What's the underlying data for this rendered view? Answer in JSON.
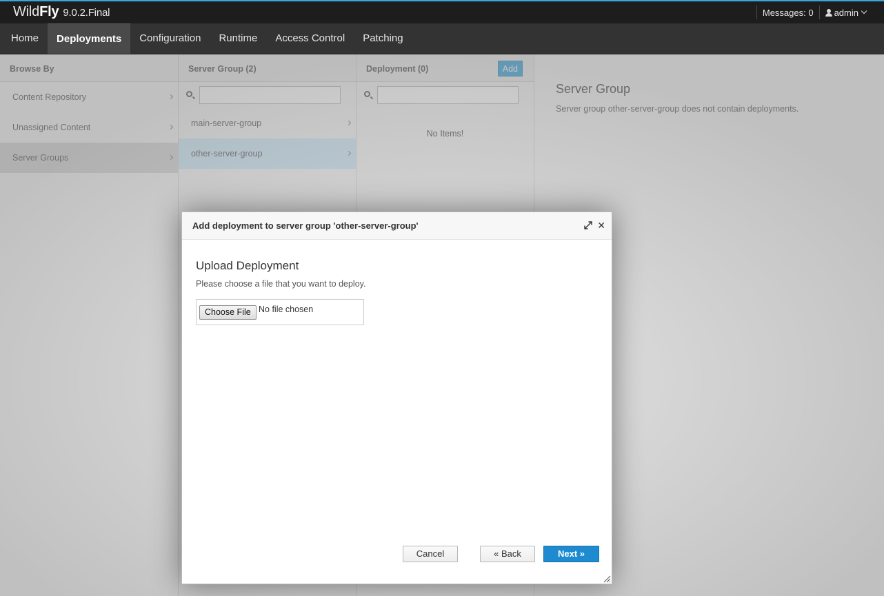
{
  "brand": {
    "wild": "Wild",
    "fly": "Fly",
    "version": "9.0.2.Final"
  },
  "topright": {
    "messages": "Messages: 0",
    "user": "admin"
  },
  "nav": [
    {
      "label": "Home"
    },
    {
      "label": "Deployments",
      "active": true
    },
    {
      "label": "Configuration"
    },
    {
      "label": "Runtime"
    },
    {
      "label": "Access Control"
    },
    {
      "label": "Patching"
    }
  ],
  "browse": {
    "title": "Browse By",
    "items": [
      {
        "label": "Content Repository"
      },
      {
        "label": "Unassigned Content"
      },
      {
        "label": "Server Groups",
        "selected": true
      }
    ]
  },
  "servergroup": {
    "title": "Server Group (2)",
    "search_placeholder": "",
    "items": [
      {
        "label": "main-server-group"
      },
      {
        "label": "other-server-group",
        "selected": true
      }
    ]
  },
  "deployment": {
    "title": "Deployment (0)",
    "add_label": "Add",
    "search_placeholder": "",
    "empty": "No Items!"
  },
  "detail": {
    "title": "Server Group",
    "text": "Server group other-server-group does not contain deployments."
  },
  "dialog": {
    "title": "Add deployment to server group 'other-server-group'",
    "heading": "Upload Deployment",
    "hint": "Please choose a file that you want to deploy.",
    "choose_file": "Choose File",
    "no_file": "No file chosen",
    "cancel": "Cancel",
    "back": "« Back",
    "next": "Next »"
  },
  "colors": {
    "accent": "#39a5dc",
    "primary_button": "#1e8ad0",
    "header_bg": "#1d1d1d",
    "nav_bg": "#333333"
  }
}
